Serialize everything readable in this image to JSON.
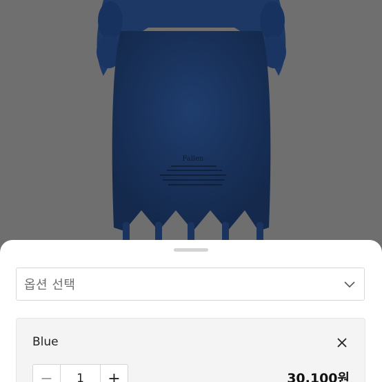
{
  "product": {
    "image_alt": "product-photo",
    "tag_text": "Fallen",
    "colors": {
      "knit": "#1f3d6e",
      "background": "#6f6f6f"
    }
  },
  "option_sheet": {
    "select_placeholder": "옵션 선택",
    "selected_option": {
      "name": "Blue",
      "quantity": "1",
      "price": "30,100원",
      "minus_symbol": "−",
      "plus_symbol": "+"
    }
  }
}
